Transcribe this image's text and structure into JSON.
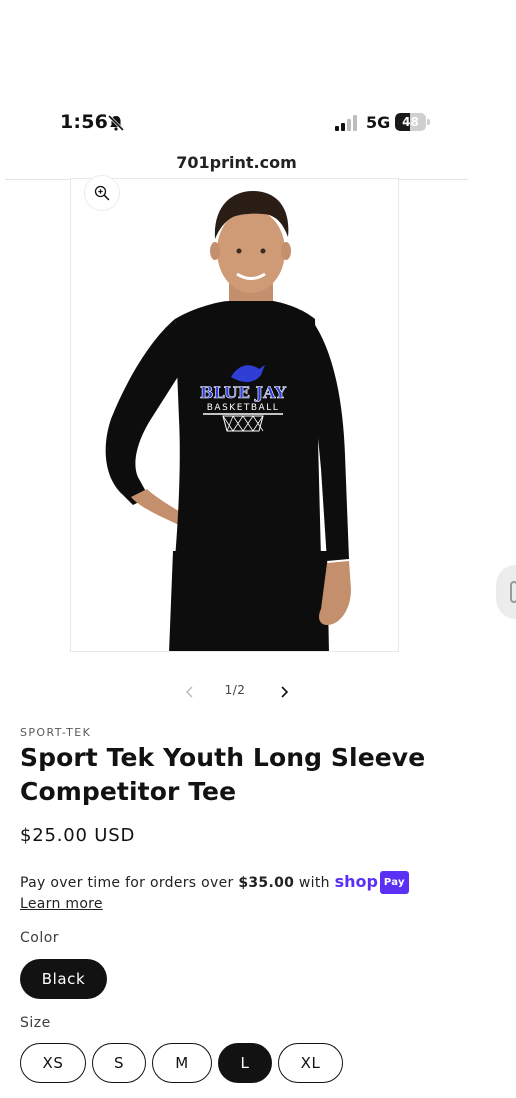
{
  "status_bar": {
    "time": "1:56",
    "network": "5G",
    "battery": "48",
    "battery_level": 0.48
  },
  "browser": {
    "url": "701print.com"
  },
  "product": {
    "image_alt": "Youth wearing black long sleeve tee with Blue Jay Basketball graphic",
    "shirt_print_title": "BLUE JAY",
    "shirt_print_subtitle": "BASKETBALL",
    "vendor": "SPORT-TEK",
    "title": "Sport Tek Youth Long Sleeve Competitor Tee",
    "price": "$25.00 USD",
    "slider_counter": "1/2"
  },
  "installments": {
    "text_before": "Pay over time for orders over ",
    "threshold": "$35.00",
    "text_after": " with ",
    "brand": "shop",
    "badge": "Pay",
    "learn_more": "Learn more"
  },
  "options": {
    "color_label": "Color",
    "color_value": "Black",
    "size_label": "Size",
    "sizes": [
      "XS",
      "S",
      "M",
      "L",
      "XL"
    ],
    "selected_size": "L"
  },
  "icons": {
    "zoom": "zoom-in-icon",
    "prev": "chevron-left-icon",
    "next": "chevron-right-icon",
    "bell": "bell-slash-icon",
    "signal": "cellular-signal-icon"
  },
  "colors": {
    "ink": "#121212",
    "shop_pay": "#5a31f4",
    "logo_blue": "#2f3fd6"
  }
}
